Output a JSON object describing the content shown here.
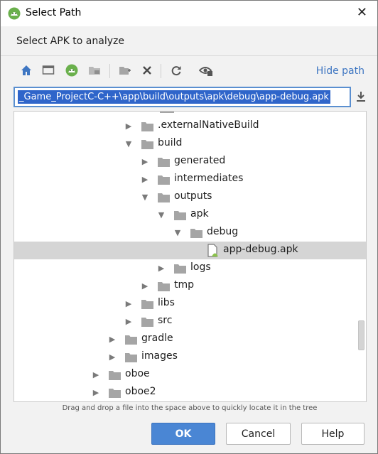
{
  "window": {
    "title": "Select Path",
    "close_glyph": "✕",
    "app_icon": "android-studio-icon"
  },
  "dialog": {
    "subtitle": "Select APK to analyze"
  },
  "toolbar": {
    "buttons": [
      {
        "name": "home-icon"
      },
      {
        "name": "desktop-icon"
      },
      {
        "name": "project-icon"
      },
      {
        "name": "module-folder-icon"
      },
      {
        "name": "new-folder-icon"
      },
      {
        "name": "delete-icon"
      },
      {
        "name": "refresh-icon"
      },
      {
        "name": "show-hidden-icon"
      }
    ],
    "hide_path_label": "Hide path"
  },
  "path": {
    "value": "_Game_ProjectC-C++\\app\\build\\outputs\\apk\\debug\\app-debug.apk"
  },
  "tree": {
    "rows": [
      {
        "label": ".externalNativeBuild",
        "depth": 4,
        "expanded": false,
        "type": "folder"
      },
      {
        "label": "build",
        "depth": 4,
        "expanded": true,
        "type": "folder"
      },
      {
        "label": "generated",
        "depth": 5,
        "expanded": false,
        "type": "folder"
      },
      {
        "label": "intermediates",
        "depth": 5,
        "expanded": false,
        "type": "folder"
      },
      {
        "label": "outputs",
        "depth": 5,
        "expanded": true,
        "type": "folder"
      },
      {
        "label": "apk",
        "depth": 6,
        "expanded": true,
        "type": "folder"
      },
      {
        "label": "debug",
        "depth": 7,
        "expanded": true,
        "type": "folder"
      },
      {
        "label": "app-debug.apk",
        "depth": 8,
        "expanded": null,
        "type": "apk",
        "selected": true
      },
      {
        "label": "logs",
        "depth": 6,
        "expanded": false,
        "type": "folder"
      },
      {
        "label": "tmp",
        "depth": 5,
        "expanded": false,
        "type": "folder"
      },
      {
        "label": "libs",
        "depth": 4,
        "expanded": false,
        "type": "folder"
      },
      {
        "label": "src",
        "depth": 4,
        "expanded": false,
        "type": "folder"
      },
      {
        "label": "gradle",
        "depth": 3,
        "expanded": false,
        "type": "folder"
      },
      {
        "label": "images",
        "depth": 3,
        "expanded": false,
        "type": "folder"
      },
      {
        "label": "oboe",
        "depth": 2,
        "expanded": false,
        "type": "folder"
      },
      {
        "label": "oboe2",
        "depth": 2,
        "expanded": false,
        "type": "folder"
      }
    ]
  },
  "hint": "Drag and drop a file into the space above to quickly locate it in the tree",
  "buttons": {
    "ok": "OK",
    "cancel": "Cancel",
    "help": "Help"
  },
  "colors": {
    "accent": "#4a86d4",
    "selection": "#2f65ca",
    "link": "#3e76c2",
    "folder": "#a5a5a5",
    "android_green": "#8bc34a"
  }
}
